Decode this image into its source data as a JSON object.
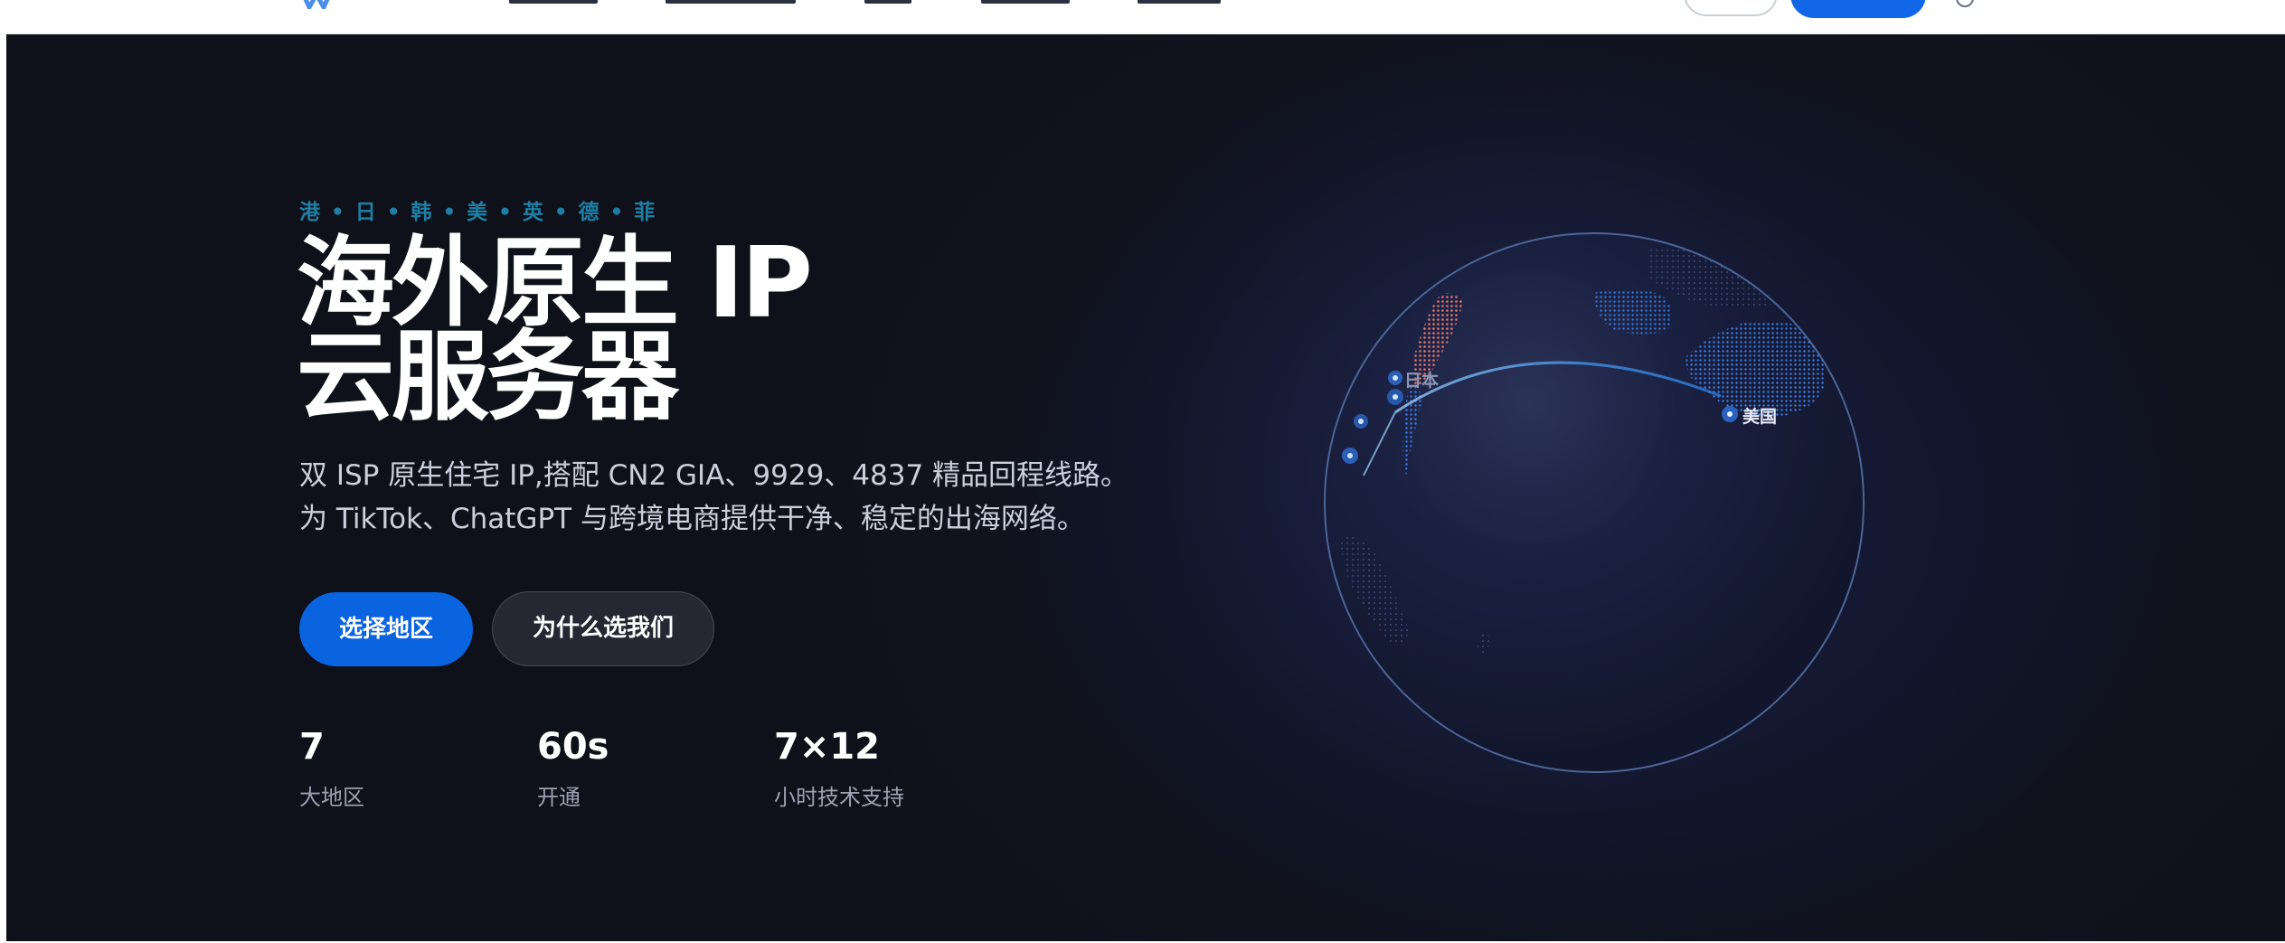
{
  "hero": {
    "regions_line": "港 • 日 • 韩 • 美 • 英 • 德 • 菲",
    "title_line1": "海外原生 IP",
    "title_line2": "云服务器",
    "subtitle": "双 ISP 原生住宅 IP,搭配 CN2 GIA、9929、4837 精品回程线路。为 TikTok、ChatGPT 与跨境电商提供干净、稳定的出海网络。",
    "primary_button": "选择地区",
    "secondary_button": "为什么选我们"
  },
  "stats": [
    {
      "value": "7",
      "label": "大地区"
    },
    {
      "value": "60s",
      "label": "开通"
    },
    {
      "value": "7×12",
      "label": "小时技术支持"
    }
  ],
  "globe": {
    "label_japan": "日本",
    "label_usa": "美国"
  },
  "colors": {
    "accent_blue": "#0a63df",
    "region_tag": "#1e7fa6",
    "hero_bg": "#0f111a",
    "highlight_red": "#e5766d"
  }
}
